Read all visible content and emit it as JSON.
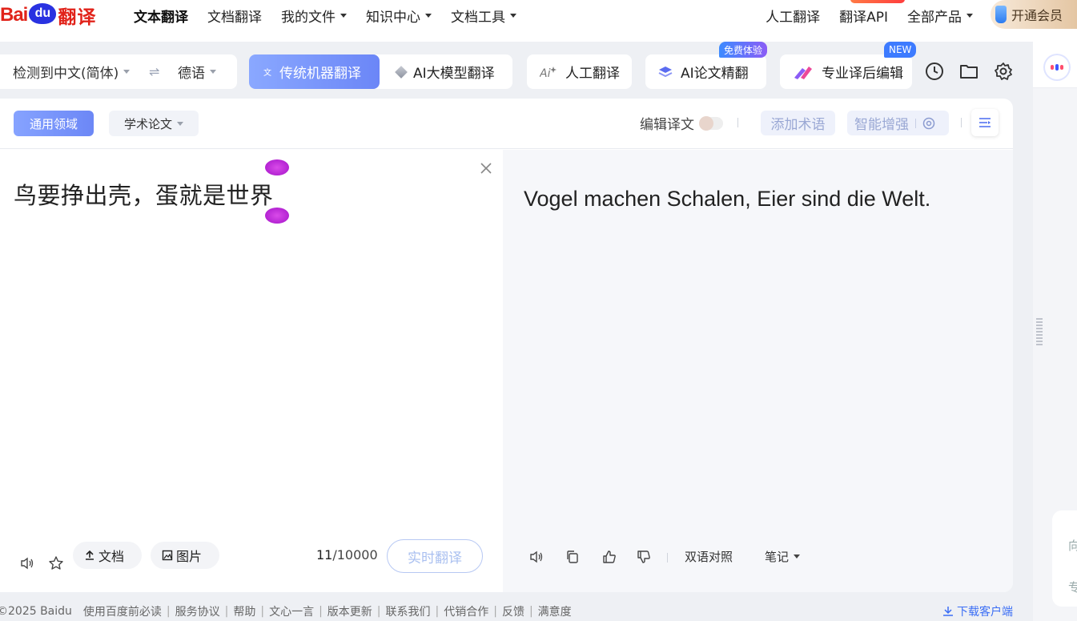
{
  "logo": {
    "bai": "Bai",
    "du": "du",
    "fanyi": "翻译"
  },
  "topnav": {
    "items": [
      {
        "label": "文本翻译",
        "active": true,
        "dropdown": false
      },
      {
        "label": "文档翻译",
        "active": false,
        "dropdown": false
      },
      {
        "label": "我的文件",
        "active": false,
        "dropdown": true
      },
      {
        "label": "知识中心",
        "active": false,
        "dropdown": true
      },
      {
        "label": "文档工具",
        "active": false,
        "dropdown": true
      }
    ],
    "right": [
      {
        "label": "人工翻译",
        "dropdown": false
      },
      {
        "label": "翻译API",
        "dropdown": false
      },
      {
        "label": "全部产品",
        "dropdown": true
      }
    ],
    "vip_label": "开通会员"
  },
  "toolbar": {
    "source_lang": "检测到中文(简体)",
    "swap_icon": "⇌",
    "target_lang": "德语",
    "mode_traditional": "传统机器翻译",
    "mode_ai": "AI大模型翻译",
    "human_translation": "人工翻译",
    "paper_translation": "AI论文精翻",
    "paper_badge": "免费体验",
    "post_edit": "专业译后编辑",
    "post_badge": "NEW"
  },
  "card": {
    "domain_general": "通用领域",
    "domain_academic": "学术论文",
    "edit_translation": "编辑译文",
    "add_terms": "添加术语",
    "smart_enhance": "智能增强"
  },
  "source": {
    "text": "鸟要挣出壳，蛋就是世界",
    "doc_btn": "文档",
    "img_btn": "图片",
    "char_count": "11",
    "char_limit": "/10000",
    "realtime_btn": "实时翻译"
  },
  "result": {
    "text": "Vogel machen Schalen, Eier sind die Welt.",
    "bilingual": "双语对照",
    "notes": "笔记"
  },
  "rail": {
    "line1": "向",
    "line2": "专"
  },
  "footer": {
    "copyright": "©2025 Baidu",
    "links": [
      "使用百度前必读",
      "服务协议",
      "帮助",
      "文心一言",
      "版本更新",
      "联系我们",
      "代销合作",
      "反馈",
      "满意度"
    ],
    "download": "下载客户端"
  },
  "colors": {
    "accent": "#6c87f6",
    "brand_red": "#e1231a",
    "brand_blue": "#2932e1"
  }
}
